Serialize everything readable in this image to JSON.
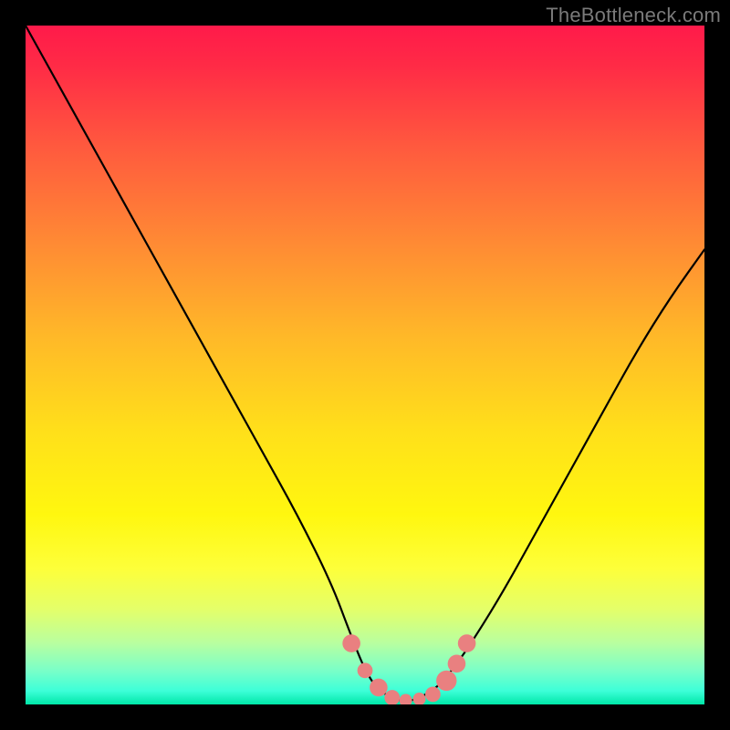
{
  "watermark": "TheBottleneck.com",
  "chart_data": {
    "type": "line",
    "title": "",
    "xlabel": "",
    "ylabel": "",
    "xlim": [
      0,
      100
    ],
    "ylim": [
      0,
      100
    ],
    "series": [
      {
        "name": "bottleneck-curve",
        "x": [
          0,
          5,
          10,
          15,
          20,
          25,
          30,
          35,
          40,
          45,
          48,
          50,
          52,
          55,
          57,
          60,
          62,
          65,
          70,
          75,
          80,
          85,
          90,
          95,
          100
        ],
        "y": [
          100,
          91,
          82,
          73,
          64,
          55,
          46,
          37,
          28,
          18,
          10,
          5,
          2,
          0.5,
          0.5,
          2,
          4,
          8,
          16,
          25,
          34,
          43,
          52,
          60,
          67
        ]
      }
    ],
    "markers": [
      {
        "x": 48,
        "y": 9,
        "r": 1.4
      },
      {
        "x": 50,
        "y": 5,
        "r": 1.2
      },
      {
        "x": 52,
        "y": 2.5,
        "r": 1.4
      },
      {
        "x": 54,
        "y": 1,
        "r": 1.2
      },
      {
        "x": 56,
        "y": 0.6,
        "r": 1.0
      },
      {
        "x": 58,
        "y": 0.8,
        "r": 1.0
      },
      {
        "x": 60,
        "y": 1.5,
        "r": 1.2
      },
      {
        "x": 62,
        "y": 3.5,
        "r": 1.6
      },
      {
        "x": 63.5,
        "y": 6,
        "r": 1.4
      },
      {
        "x": 65,
        "y": 9,
        "r": 1.4
      }
    ],
    "marker_color": "#e98080",
    "curve_color": "#000000",
    "background_gradient": [
      "#ff1a4a",
      "#ffe01a",
      "#00e7a8"
    ]
  }
}
